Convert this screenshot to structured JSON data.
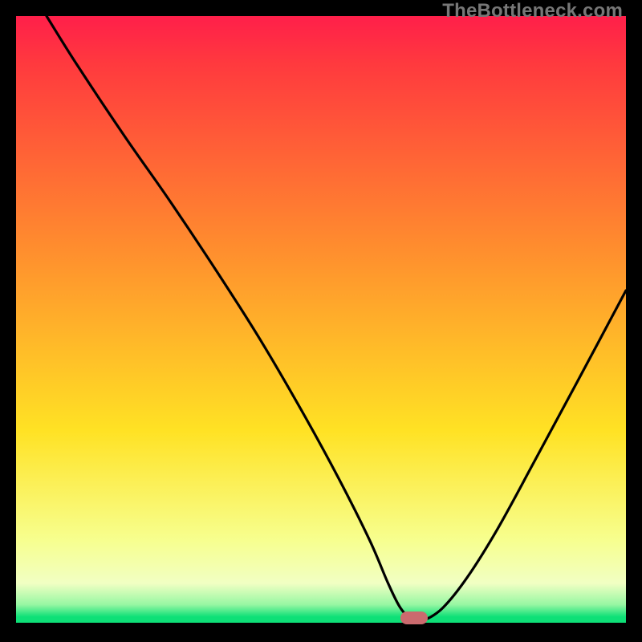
{
  "watermark": "TheBottleneck.com",
  "colors": {
    "top": "#ff1f4a",
    "red": "#ff3a3e",
    "orange": "#ff8d2e",
    "yellow": "#ffe224",
    "pale": "#f7ff8f",
    "cream": "#f1ffc3",
    "lightgreen": "#97f7a3",
    "green": "#0ee077",
    "marker": "#cb6a6e",
    "axis": "#000000"
  },
  "chart_data": {
    "type": "line",
    "title": "",
    "xlabel": "",
    "ylabel": "",
    "xlim": [
      0,
      100
    ],
    "ylim": [
      0,
      100
    ],
    "grid": false,
    "legend": false,
    "x": [
      5,
      10,
      18,
      25,
      33,
      40,
      47,
      53,
      58,
      61,
      63,
      65,
      67,
      70,
      74,
      79,
      85,
      92,
      100
    ],
    "y": [
      100,
      92,
      80,
      70,
      58,
      47,
      35,
      24,
      14,
      7,
      3,
      1,
      1,
      3,
      8,
      16,
      27,
      40,
      55
    ],
    "optimum_marker": {
      "x": 65.3,
      "y": 1.3
    },
    "gradient_stops": [
      {
        "offset": 0.0,
        "key": "top"
      },
      {
        "offset": 0.08,
        "key": "red"
      },
      {
        "offset": 0.38,
        "key": "orange"
      },
      {
        "offset": 0.68,
        "key": "yellow"
      },
      {
        "offset": 0.86,
        "key": "pale"
      },
      {
        "offset": 0.93,
        "key": "cream"
      },
      {
        "offset": 0.965,
        "key": "lightgreen"
      },
      {
        "offset": 0.985,
        "key": "green"
      },
      {
        "offset": 1.0,
        "key": "green"
      }
    ]
  }
}
